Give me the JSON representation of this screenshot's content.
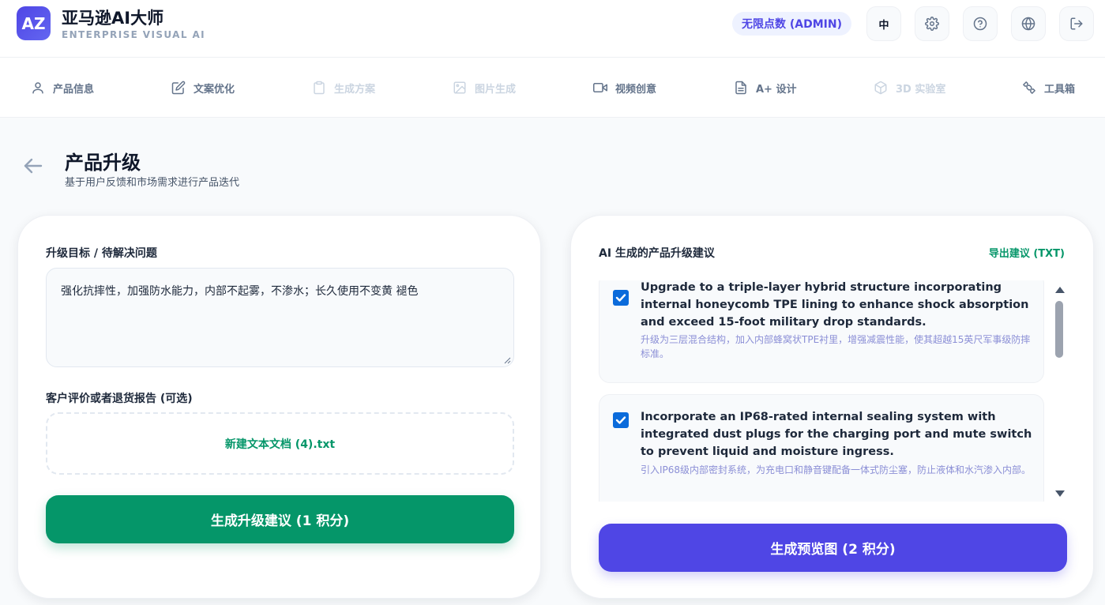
{
  "app": {
    "logo_text": "AZ",
    "title": "亚马逊AI大师",
    "subtitle": "ENTERPRISE VISUAL AI",
    "points_badge": "无限点数 (ADMIN)",
    "lang_button": "中"
  },
  "tabs": [
    {
      "label": "产品信息",
      "icon": "user-icon",
      "disabled": false
    },
    {
      "label": "文案优化",
      "icon": "edit-icon",
      "disabled": false
    },
    {
      "label": "生成方案",
      "icon": "clipboard-icon",
      "disabled": true
    },
    {
      "label": "图片生成",
      "icon": "image-icon",
      "disabled": true
    },
    {
      "label": "视频创意",
      "icon": "video-icon",
      "disabled": false
    },
    {
      "label": "A+ 设计",
      "icon": "document-icon",
      "disabled": false
    },
    {
      "label": "3D 实验室",
      "icon": "cube-icon",
      "disabled": true
    },
    {
      "label": "工具箱",
      "icon": "puzzle-icon",
      "disabled": false
    }
  ],
  "page": {
    "title": "产品升级",
    "subtitle": "基于用户反馈和市场需求进行产品迭代"
  },
  "left_panel": {
    "goal_label": "升级目标 / 待解决问题",
    "goal_value": "强化抗摔性，加强防水能力，内部不起雾，不渗水；长久使用不变黄 褪色",
    "reviews_label": "客户评价或者退货报告 (可选)",
    "uploaded_file": "新建文本文档 (4).txt",
    "generate_button": "生成升级建议 (1 积分)"
  },
  "right_panel": {
    "title": "AI 生成的产品升级建议",
    "export_link": "导出建议 (TXT)",
    "suggestions": [
      {
        "checked": true,
        "en": "Upgrade to a triple-layer hybrid structure incorporating internal honeycomb TPE lining to enhance shock absorption and exceed 15-foot military drop standards.",
        "zh": "升级为三层混合结构，加入内部蜂窝状TPE衬里，增强减震性能，使其超越15英尺军事级防摔标准。"
      },
      {
        "checked": true,
        "en": "Incorporate an IP68-rated internal sealing system with integrated dust plugs for the charging port and mute switch to prevent liquid and moisture ingress.",
        "zh": "引入IP68级内部密封系统，为充电口和静音键配备一体式防尘塞，防止液体和水汽渗入内部。"
      }
    ],
    "preview_button": "生成预览图 (2 积分)"
  },
  "colors": {
    "accent_purple": "#4f46e5",
    "accent_green": "#059669"
  }
}
